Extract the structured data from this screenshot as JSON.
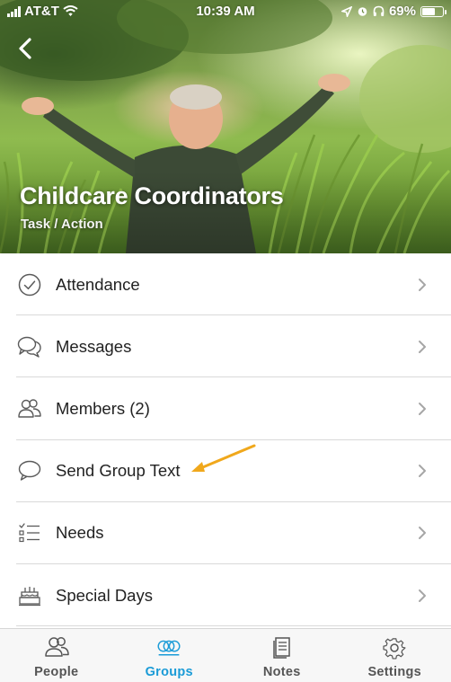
{
  "status_bar": {
    "carrier": "AT&T",
    "time": "10:39 AM",
    "battery": "69%",
    "battery_level": 0.69,
    "icons": [
      "signal-icon",
      "wifi-icon",
      "location-icon",
      "alarm-icon",
      "headphones-icon",
      "battery-icon"
    ]
  },
  "header": {
    "back_icon": "back-chevron-icon",
    "title": "Childcare Coordinators",
    "subtitle": "Task / Action"
  },
  "menu": {
    "items": [
      {
        "label": "Attendance",
        "icon": "check-circle-icon"
      },
      {
        "label": "Messages",
        "icon": "chat-bubbles-icon"
      },
      {
        "label": "Members (2)",
        "icon": "members-icon"
      },
      {
        "label": "Send Group Text",
        "icon": "speech-bubble-icon"
      },
      {
        "label": "Needs",
        "icon": "checklist-icon"
      },
      {
        "label": "Special Days",
        "icon": "cake-icon"
      }
    ],
    "chevron_icon": "chevron-right-icon"
  },
  "annotation": {
    "icon": "arrow-pointer-icon",
    "color": "#f0a81c"
  },
  "tab_bar": {
    "tabs": [
      {
        "label": "People",
        "icon": "people-icon",
        "active": false
      },
      {
        "label": "Groups",
        "icon": "groups-icon",
        "active": true
      },
      {
        "label": "Notes",
        "icon": "notes-icon",
        "active": false
      },
      {
        "label": "Settings",
        "icon": "gear-icon",
        "active": false
      }
    ],
    "active_color": "#1a9bd7",
    "inactive_color": "#555555"
  }
}
